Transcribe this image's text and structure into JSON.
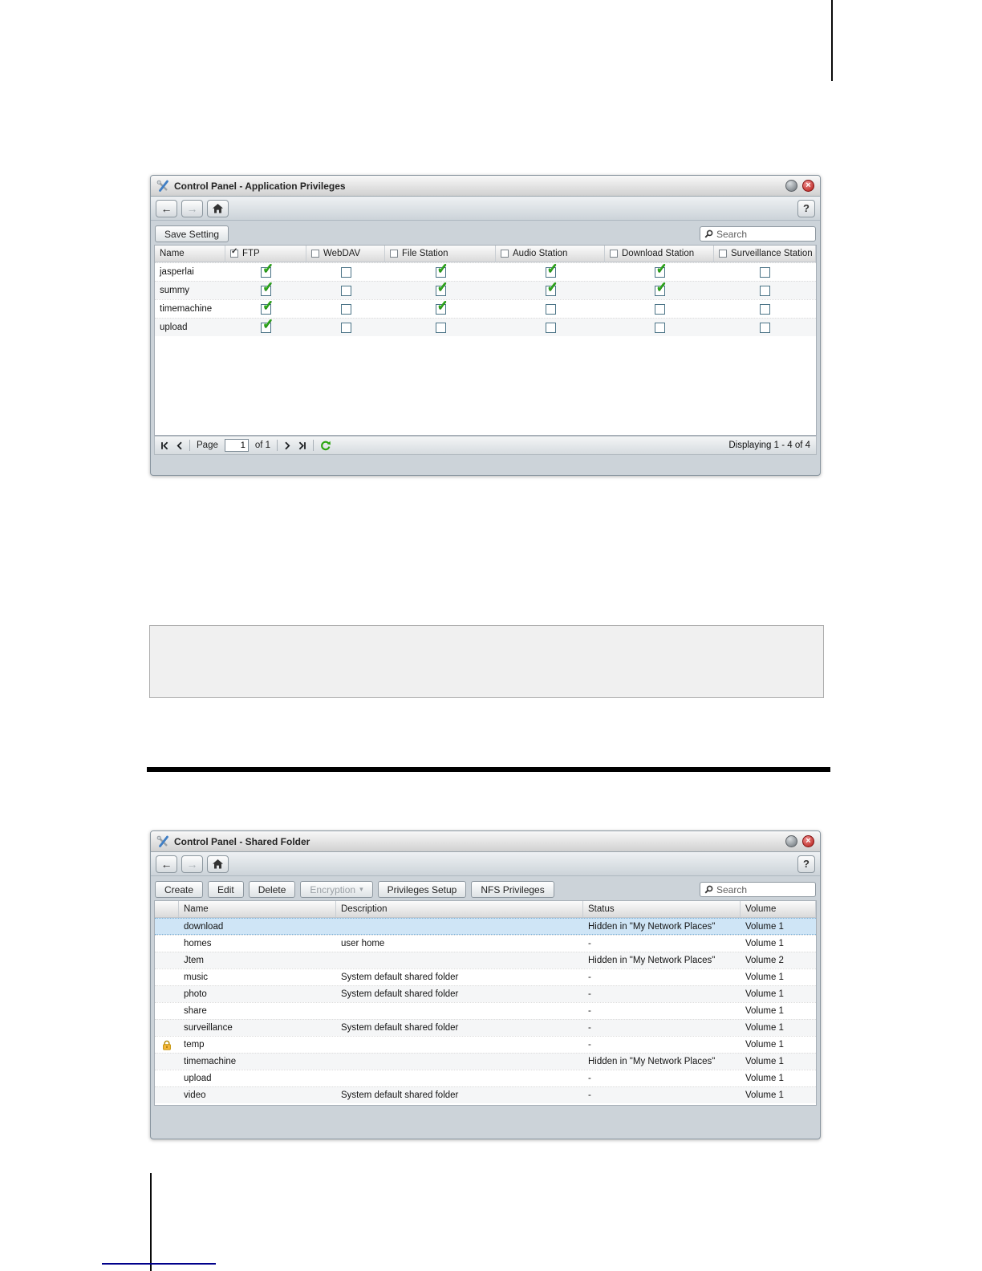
{
  "window1": {
    "title": "Control Panel - Application Privileges",
    "titlebar": {
      "close_glyph": "×"
    },
    "nav": {
      "back": "←",
      "forward": "→",
      "help": "?"
    },
    "save_button": "Save Setting",
    "search_placeholder": "Search",
    "columns": [
      {
        "key": "name",
        "label": "Name"
      },
      {
        "key": "ftp",
        "label": "FTP",
        "header_checked": true
      },
      {
        "key": "webdav",
        "label": "WebDAV",
        "header_checked": false
      },
      {
        "key": "file_station",
        "label": "File Station",
        "header_checked": false
      },
      {
        "key": "audio_station",
        "label": "Audio Station",
        "header_checked": false
      },
      {
        "key": "download_station",
        "label": "Download Station",
        "header_checked": false
      },
      {
        "key": "surveillance_station",
        "label": "Surveillance Station",
        "header_checked": false
      }
    ],
    "rows": [
      {
        "name": "jasperlai",
        "ftp": true,
        "webdav": false,
        "file_station": true,
        "audio_station": true,
        "download_station": true,
        "surveillance_station": false
      },
      {
        "name": "summy",
        "ftp": true,
        "webdav": false,
        "file_station": true,
        "audio_station": true,
        "download_station": true,
        "surveillance_station": false
      },
      {
        "name": "timemachine",
        "ftp": true,
        "webdav": false,
        "file_station": true,
        "audio_station": false,
        "download_station": false,
        "surveillance_station": false
      },
      {
        "name": "upload",
        "ftp": true,
        "webdav": false,
        "file_station": false,
        "audio_station": false,
        "download_station": false,
        "surveillance_station": false
      }
    ],
    "pagination": {
      "page_label": "Page",
      "page_value": "1",
      "of_label": "of 1",
      "displaying": "Displaying 1 - 4 of 4"
    }
  },
  "window2": {
    "title": "Control Panel - Shared Folder",
    "titlebar": {
      "close_glyph": "×"
    },
    "nav": {
      "back": "←",
      "forward": "→",
      "help": "?"
    },
    "toolbar_buttons": [
      {
        "label": "Create",
        "enabled": true,
        "has_dropdown": false
      },
      {
        "label": "Edit",
        "enabled": true,
        "has_dropdown": false
      },
      {
        "label": "Delete",
        "enabled": true,
        "has_dropdown": false
      },
      {
        "label": "Encryption",
        "enabled": false,
        "has_dropdown": true
      },
      {
        "label": "Privileges Setup",
        "enabled": true,
        "has_dropdown": false
      },
      {
        "label": "NFS Privileges",
        "enabled": true,
        "has_dropdown": false
      }
    ],
    "search_placeholder": "Search",
    "columns": [
      "Name",
      "Description",
      "Status",
      "Volume"
    ],
    "rows": [
      {
        "name": "download",
        "description": "",
        "status": "Hidden in \"My Network Places\"",
        "volume": "Volume 1",
        "selected": true,
        "locked": false
      },
      {
        "name": "homes",
        "description": "user home",
        "status": "-",
        "volume": "Volume 1",
        "selected": false,
        "locked": false
      },
      {
        "name": "Jtem",
        "description": "",
        "status": "Hidden in \"My Network Places\"",
        "volume": "Volume 2",
        "selected": false,
        "locked": false
      },
      {
        "name": "music",
        "description": "System default shared folder",
        "status": "-",
        "volume": "Volume 1",
        "selected": false,
        "locked": false
      },
      {
        "name": "photo",
        "description": "System default shared folder",
        "status": "-",
        "volume": "Volume 1",
        "selected": false,
        "locked": false
      },
      {
        "name": "share",
        "description": "",
        "status": "-",
        "volume": "Volume 1",
        "selected": false,
        "locked": false
      },
      {
        "name": "surveillance",
        "description": "System default shared folder",
        "status": "-",
        "volume": "Volume 1",
        "selected": false,
        "locked": false
      },
      {
        "name": "temp",
        "description": "",
        "status": "-",
        "volume": "Volume 1",
        "selected": false,
        "locked": true
      },
      {
        "name": "timemachine",
        "description": "",
        "status": "Hidden in \"My Network Places\"",
        "volume": "Volume 1",
        "selected": false,
        "locked": false
      },
      {
        "name": "upload",
        "description": "",
        "status": "-",
        "volume": "Volume 1",
        "selected": false,
        "locked": false
      },
      {
        "name": "video",
        "description": "System default shared folder",
        "status": "-",
        "volume": "Volume 1",
        "selected": false,
        "locked": false
      }
    ]
  },
  "colors": {
    "check_green": "#2fa61c",
    "selected_row_blue": "#cfe5f6",
    "close_red": "#b51a14",
    "lock_gold": "#f6b73c",
    "divider_navy": "#00008b"
  }
}
